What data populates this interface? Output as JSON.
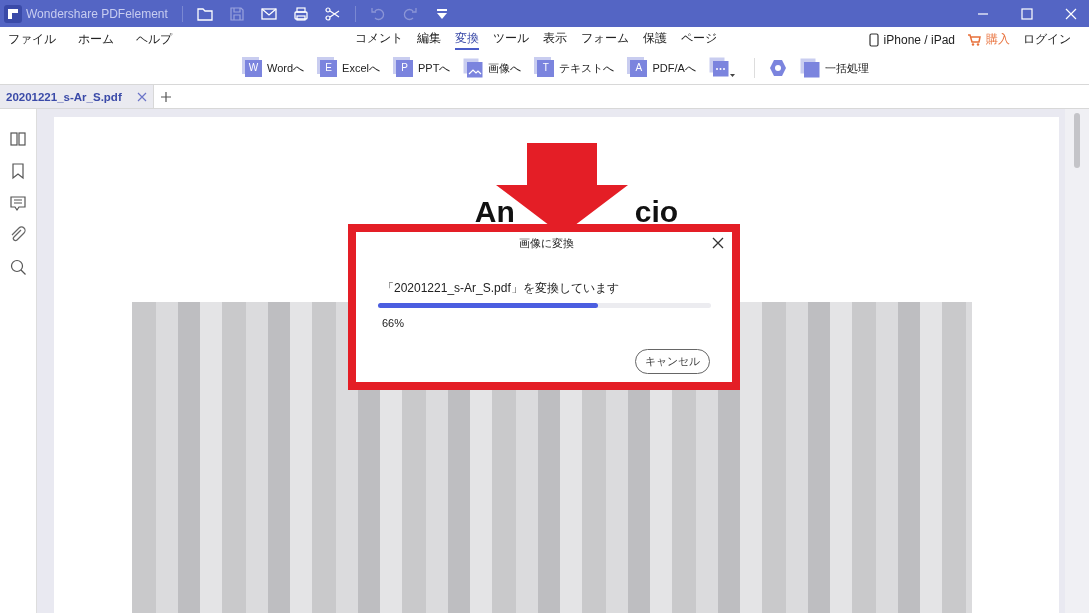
{
  "window": {
    "title": "Wondershare PDFelement"
  },
  "menu": [
    {
      "label": "ファイル"
    },
    {
      "label": "ホーム"
    },
    {
      "label": "ヘルプ"
    }
  ],
  "ribbon_tabs": [
    {
      "label": "コメント",
      "selected": false
    },
    {
      "label": "編集",
      "selected": false
    },
    {
      "label": "変換",
      "selected": true
    },
    {
      "label": "ツール",
      "selected": false
    },
    {
      "label": "表示",
      "selected": false
    },
    {
      "label": "フォーム",
      "selected": false
    },
    {
      "label": "保護",
      "selected": false
    },
    {
      "label": "ページ",
      "selected": false
    }
  ],
  "account": {
    "device": "iPhone / iPad",
    "buy": "購入",
    "login": "ログイン"
  },
  "convert_tools": [
    {
      "kind": "letter",
      "icon_letter": "W",
      "label": "Wordへ"
    },
    {
      "kind": "letter",
      "icon_letter": "E",
      "label": "Excelへ"
    },
    {
      "kind": "letter",
      "icon_letter": "P",
      "label": "PPTへ"
    },
    {
      "kind": "image",
      "label": "画像へ"
    },
    {
      "kind": "letter",
      "icon_letter": "T",
      "label": "テキストへ"
    },
    {
      "kind": "letter",
      "icon_letter": "A",
      "label": "PDF/Aへ"
    },
    {
      "kind": "more"
    },
    {
      "kind": "hexagon"
    },
    {
      "kind": "batch",
      "label": "一括処理"
    }
  ],
  "document_tabs": [
    {
      "label": "20201221_s-Ar_S.pdf",
      "selected": true
    }
  ],
  "document": {
    "heading_parts": [
      "An",
      "cio"
    ]
  },
  "dialog": {
    "title": "画像に変換",
    "message": "「20201221_s-Ar_S.pdf」を変換しています",
    "level": 0.66,
    "percent": "66%",
    "cancel": "キャンセル"
  }
}
